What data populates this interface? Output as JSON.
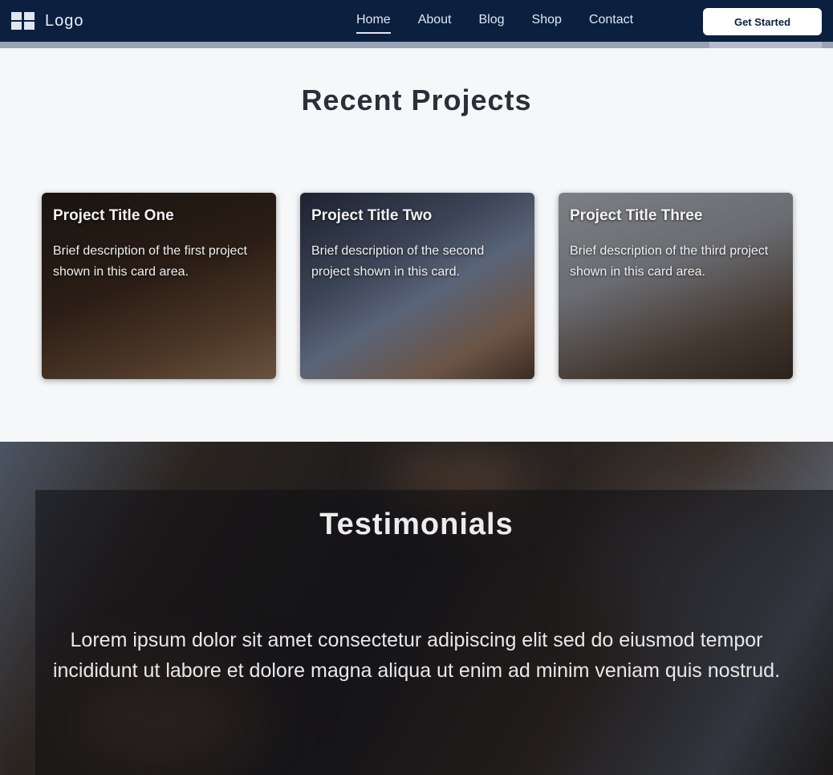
{
  "header": {
    "brand": "Logo",
    "nav": [
      {
        "label": "Home"
      },
      {
        "label": "About"
      },
      {
        "label": "Blog"
      },
      {
        "label": "Shop"
      },
      {
        "label": "Contact"
      }
    ],
    "cta_label": "Get Started",
    "colors": {
      "bar": "#0b1f3f",
      "accent": "#ffffff"
    }
  },
  "features": {
    "title": "Recent Projects",
    "cards": [
      {
        "title": "Project Title One",
        "text": "Brief description of the first project shown in this card area."
      },
      {
        "title": "Project Title Two",
        "text": "Brief description of the second project shown in this card."
      },
      {
        "title": "Project Title Three",
        "text": "Brief description of the third project shown in this card area."
      }
    ]
  },
  "testimonial": {
    "title": "Testimonials",
    "quote": "Lorem ipsum dolor sit amet consectetur adipiscing elit sed do eiusmod tempor incididunt ut labore et dolore magna aliqua ut enim ad minim veniam quis nostrud."
  }
}
